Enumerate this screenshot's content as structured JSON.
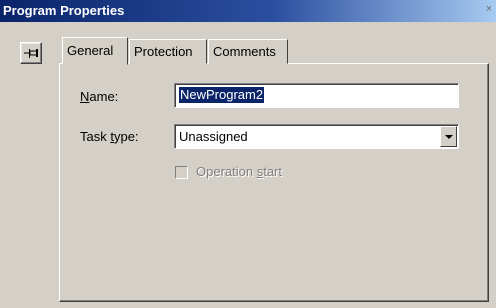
{
  "window": {
    "title": "Program Properties",
    "close_glyph": "×"
  },
  "pin": {
    "icon": "pushpin-icon"
  },
  "tabs": [
    {
      "label": "General",
      "active": true
    },
    {
      "label": "Protection",
      "active": false
    },
    {
      "label": "Comments",
      "active": false
    }
  ],
  "general": {
    "name_label_key": "N",
    "name_label_rest": "ame:",
    "name_value": "NewProgram2",
    "task_label_pre": "Task ",
    "task_label_key": "t",
    "task_label_post": "ype:",
    "task_value": "Unassigned",
    "op_label_pre": "Operation ",
    "op_label_key": "s",
    "op_label_post": "tart",
    "op_checked": false,
    "op_enabled": false
  },
  "colors": {
    "face": "#d4d0c8",
    "title_start": "#0a246a",
    "title_end": "#a6caf0",
    "selection": "#0a246a"
  }
}
